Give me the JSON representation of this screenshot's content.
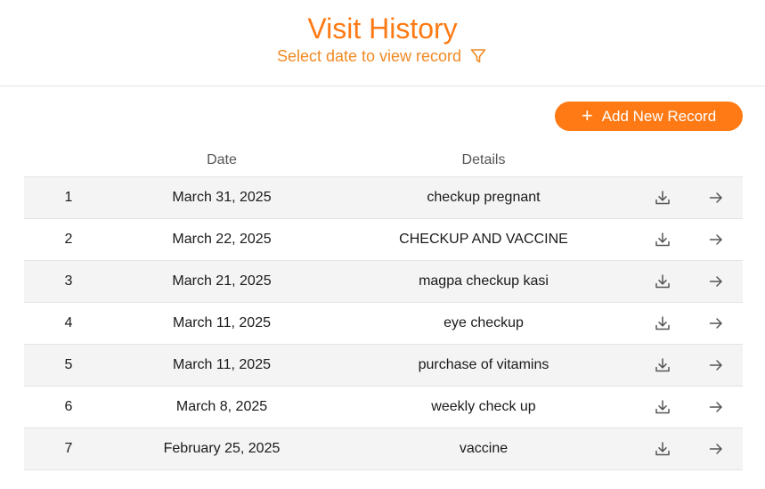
{
  "header": {
    "title": "Visit History",
    "subtitle": "Select date to view record",
    "filter_icon": "filter-icon"
  },
  "actions": {
    "add_label": "Add New Record",
    "add_icon": "plus-icon"
  },
  "table": {
    "columns": [
      "",
      "Date",
      "Details",
      "",
      ""
    ],
    "rows": [
      {
        "num": "1",
        "date": "March 31, 2025",
        "details": "checkup pregnant"
      },
      {
        "num": "2",
        "date": "March 22, 2025",
        "details": "CHECKUP AND VACCINE"
      },
      {
        "num": "3",
        "date": "March 21, 2025",
        "details": "magpa checkup kasi"
      },
      {
        "num": "4",
        "date": "March 11, 2025",
        "details": "eye checkup"
      },
      {
        "num": "5",
        "date": "March 11, 2025",
        "details": "purchase of vitamins"
      },
      {
        "num": "6",
        "date": "March 8, 2025",
        "details": "weekly check up"
      },
      {
        "num": "7",
        "date": "February 25, 2025",
        "details": "vaccine"
      }
    ],
    "row_icons": [
      "download-icon",
      "arrow-right-icon"
    ]
  },
  "colors": {
    "accent": "#ff7a14",
    "row_alt": "#f4f4f4",
    "divider": "#e3e3e3"
  }
}
